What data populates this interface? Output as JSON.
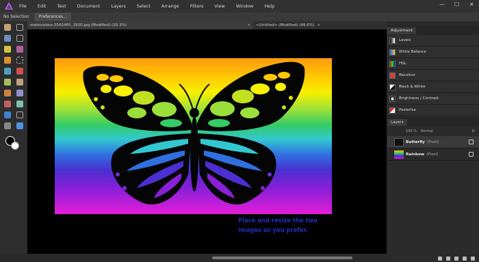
{
  "menubar": {
    "items": [
      "File",
      "Edit",
      "Text",
      "Document",
      "Layers",
      "Select",
      "Arrange",
      "Filters",
      "View",
      "Window",
      "Help"
    ]
  },
  "context_toolbar": {
    "selection_label": "No Selection",
    "preferences_button": "Preferences..."
  },
  "tabs": [
    {
      "label": "watercolour-2542465_1920.jpg (Modified) (26.3%)",
      "close": "×"
    },
    {
      "label": "<Untitled> (Modified) (49.6%)",
      "close": "×"
    }
  ],
  "canvas": {
    "caption_line1": "Place and resize the two",
    "caption_line2": "images as you prefer."
  },
  "adjustment_panel": {
    "tab_label": "Adjustment",
    "items": [
      {
        "label": "Levels",
        "icon": "levels-icon"
      },
      {
        "label": "White Balance",
        "icon": "white-balance-icon"
      },
      {
        "label": "HSL",
        "icon": "hsl-icon"
      },
      {
        "label": "Recolour",
        "icon": "recolour-icon"
      },
      {
        "label": "Black & White",
        "icon": "black-white-icon"
      },
      {
        "label": "Brightness / Contrast",
        "icon": "brightness-contrast-icon"
      },
      {
        "label": "Posterise",
        "icon": "posterise-icon"
      }
    ]
  },
  "layers_panel": {
    "tab_label": "Layers",
    "opacity": "100 %",
    "blend_mode": "Normal",
    "layers": [
      {
        "name": "Butterfly",
        "type": "(Pixel)"
      },
      {
        "name": "Rainbow",
        "type": "(Pixel)"
      }
    ]
  },
  "colors": {
    "accent_logo": "#b36ad8",
    "caption_text": "#1f2cc0"
  }
}
